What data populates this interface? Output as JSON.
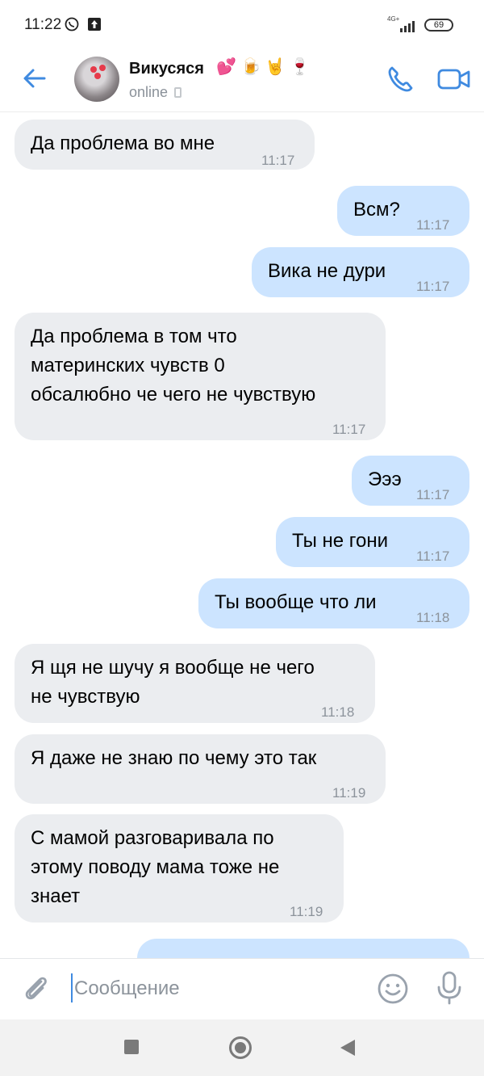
{
  "status_bar": {
    "time": "11:22",
    "network": "4G+",
    "battery": "69"
  },
  "header": {
    "contact_name": "Викусяся",
    "contact_emoji": "💕 🍺 🤘 🍷",
    "status": "online"
  },
  "messages": [
    {
      "dir": "in",
      "text": "Да проблема во мне",
      "time": "11:17"
    },
    {
      "dir": "out",
      "text": "Всм?",
      "time": "11:17"
    },
    {
      "dir": "out",
      "text": "Вика не дури",
      "time": "11:17"
    },
    {
      "dir": "in",
      "text": "Да проблема в том что\nматеринских чувств 0\nобсалюбно че чего не чувствую",
      "time": "11:17"
    },
    {
      "dir": "out",
      "text": "Эээ",
      "time": "11:17"
    },
    {
      "dir": "out",
      "text": "Ты не гони",
      "time": "11:17"
    },
    {
      "dir": "out",
      "text": "Ты вообще что ли",
      "time": "11:18"
    },
    {
      "dir": "in",
      "text": "Я щя не шучу я вообще не чего\nне чувствую",
      "time": "11:18"
    },
    {
      "dir": "in",
      "text": "Я даже не знаю по чему это так",
      "time": "11:19"
    },
    {
      "dir": "in",
      "text": "С мамой разговаривала по\nэтому поводу мама тоже не\nзнает",
      "time": "11:19"
    }
  ],
  "composer": {
    "placeholder": "Сообщение"
  },
  "colors": {
    "accent": "#3f8ae0",
    "incoming_bubble": "#ebedf0",
    "outgoing_bubble": "#cce4ff"
  },
  "icons": [
    "back-arrow-icon",
    "phone-icon",
    "video-camera-icon",
    "paperclip-icon",
    "emoji-icon",
    "microphone-icon"
  ]
}
